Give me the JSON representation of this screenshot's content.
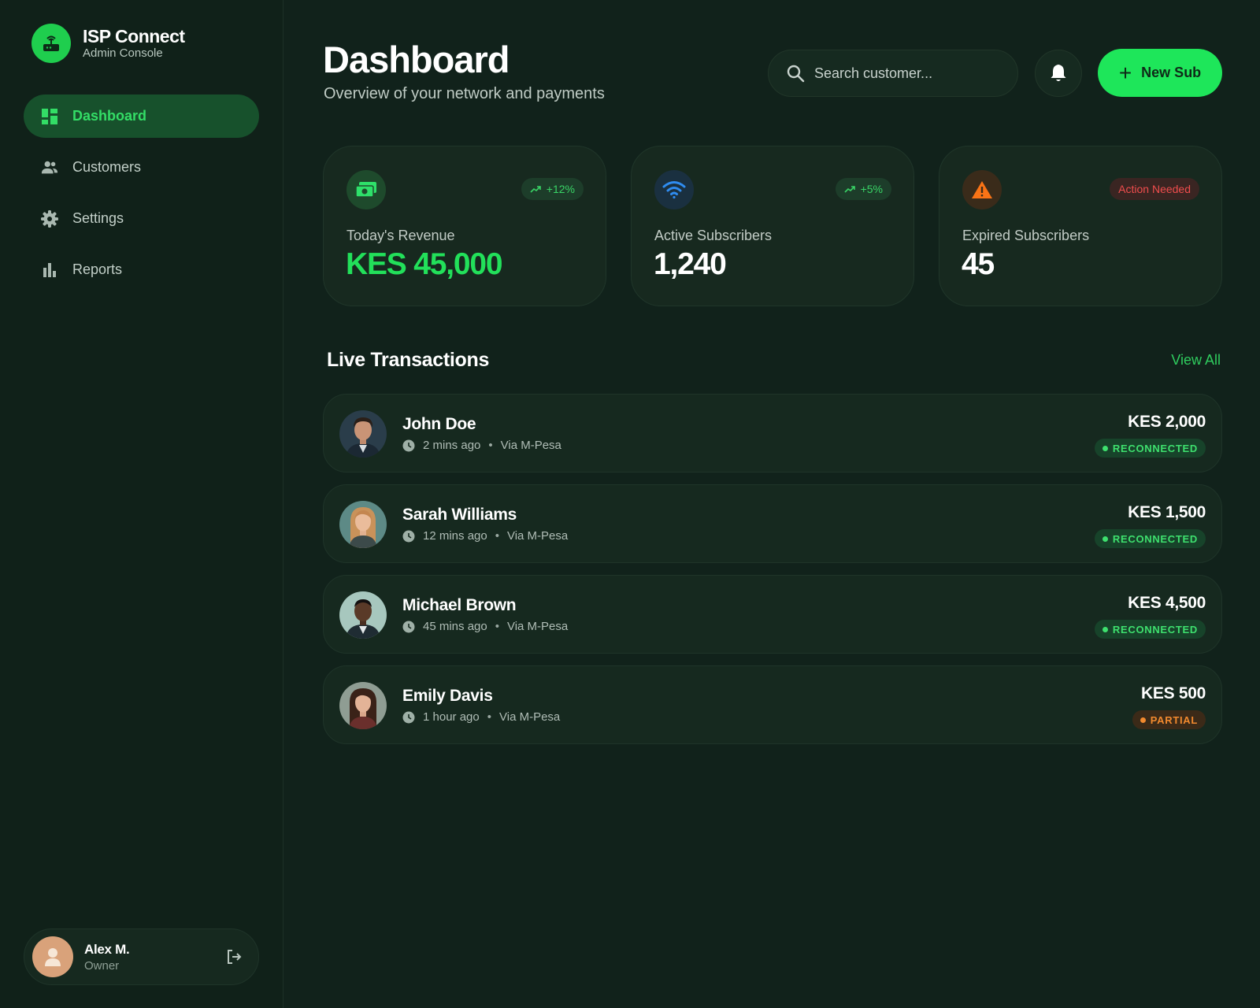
{
  "brand": {
    "title": "ISP Connect",
    "subtitle": "Admin Console",
    "logo_icon": "router-icon"
  },
  "sidebar": {
    "items": [
      {
        "label": "Dashboard",
        "icon": "dashboard-icon",
        "active": true
      },
      {
        "label": "Customers",
        "icon": "users-icon",
        "active": false
      },
      {
        "label": "Settings",
        "icon": "gear-icon",
        "active": false
      },
      {
        "label": "Reports",
        "icon": "bar-chart-icon",
        "active": false
      }
    ]
  },
  "user": {
    "name": "Alex M.",
    "role": "Owner",
    "logout_icon": "logout-icon"
  },
  "header": {
    "title": "Dashboard",
    "subtitle": "Overview of your network and payments",
    "search_placeholder": "Search customer...",
    "new_button_label": "New Sub"
  },
  "stats": [
    {
      "label": "Today's Revenue",
      "value": "KES 45,000",
      "badge": "+12%",
      "icon": "cash-icon",
      "value_color": "#22e05a"
    },
    {
      "label": "Active Subscribers",
      "value": "1,240",
      "badge": "+5%",
      "icon": "wifi-icon",
      "value_color": "#ffffff"
    },
    {
      "label": "Expired Subscribers",
      "value": "45",
      "badge": "Action Needed",
      "icon": "warning-icon",
      "value_color": "#ffffff"
    }
  ],
  "transactions": {
    "title": "Live Transactions",
    "view_all": "View All",
    "rows": [
      {
        "name": "John Doe",
        "time": "2 mins ago",
        "method": "Via M-Pesa",
        "amount": "KES 2,000",
        "status": "RECONNECTED"
      },
      {
        "name": "Sarah Williams",
        "time": "12 mins ago",
        "method": "Via M-Pesa",
        "amount": "KES 1,500",
        "status": "RECONNECTED"
      },
      {
        "name": "Michael Brown",
        "time": "45 mins ago",
        "method": "Via M-Pesa",
        "amount": "KES 4,500",
        "status": "RECONNECTED"
      },
      {
        "name": "Emily Davis",
        "time": "1 hour ago",
        "method": "Via M-Pesa",
        "amount": "KES 500",
        "status": "PARTIAL"
      }
    ]
  },
  "colors": {
    "background": "#11221b",
    "accent": "#1ee65a",
    "active_nav": "#17512c",
    "warning": "#f97316",
    "danger_text": "#f04d4d"
  }
}
